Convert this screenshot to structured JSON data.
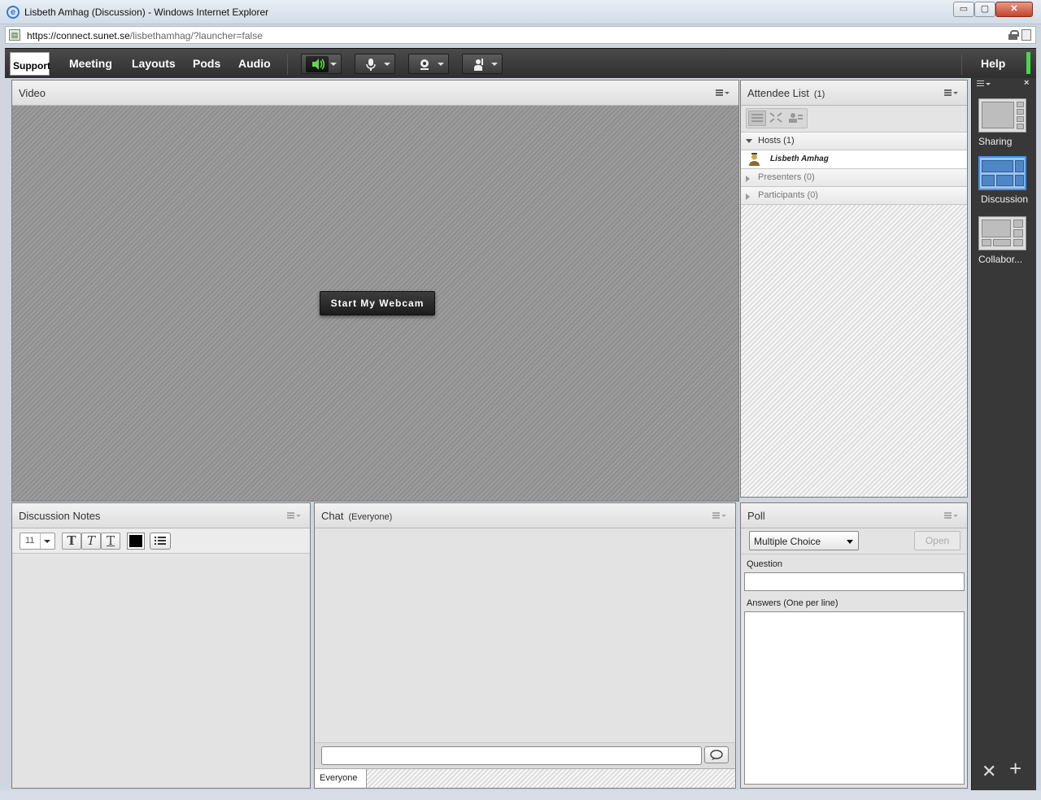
{
  "window": {
    "title": "Lisbeth Amhag (Discussion) - Windows Internet Explorer",
    "url_prefix": "https://connect.",
    "url_domain": "sunet.se",
    "url_path": "/lisbethamhag/?launcher=false",
    "min_label": "▭",
    "max_label": "▢",
    "close_label": "✕"
  },
  "menubar": {
    "logo_label": "Support",
    "items": [
      "Meeting",
      "Layouts",
      "Pods",
      "Audio"
    ],
    "help_label": "Help",
    "accent_color": "#44d84a"
  },
  "video_pod": {
    "title": "Video",
    "start_webcam_label": "Start My Webcam"
  },
  "attendee_pod": {
    "title": "Attendee List",
    "count": "(1)",
    "groups": {
      "hosts": "Hosts (1)",
      "presenters": "Presenters (0)",
      "participants": "Participants (0)"
    },
    "host_name": "Lisbeth Amhag"
  },
  "notes_pod": {
    "title": "Discussion Notes",
    "font_size": "11",
    "bold_glyph": "T",
    "italic_glyph": "T",
    "underline_glyph": "T"
  },
  "chat_pod": {
    "title": "Chat",
    "audience": "(Everyone)",
    "input_value": "",
    "tab_label": "Everyone"
  },
  "poll_pod": {
    "title": "Poll",
    "type_value": "Multiple Choice",
    "open_label": "Open",
    "question_label": "Question",
    "question_value": "",
    "answers_label": "Answers (One per line)",
    "answers_value": ""
  },
  "layouts_bar": {
    "items": [
      "Sharing",
      "Discussion",
      "Collabor..."
    ],
    "selected": "Discussion",
    "selected_color": "#3b94f0",
    "close_label": "×",
    "tools_label": "✕",
    "add_label": "+"
  }
}
